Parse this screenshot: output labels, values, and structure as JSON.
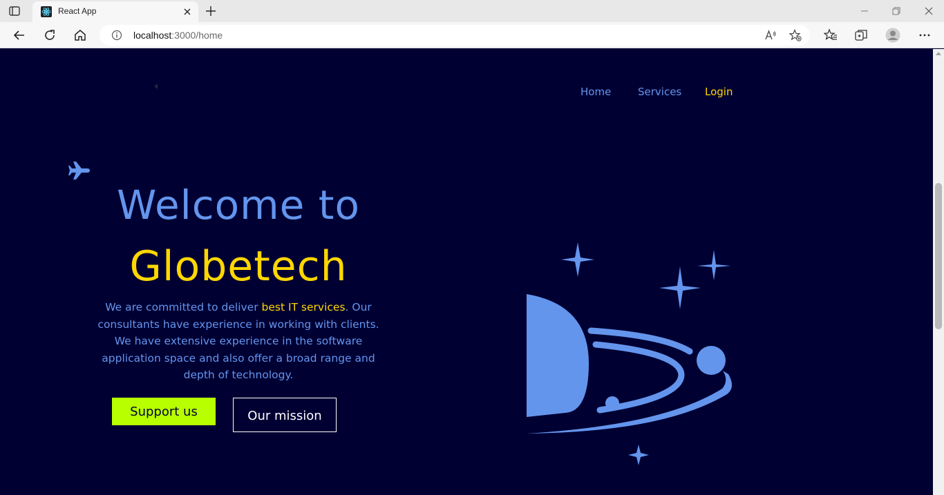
{
  "browser": {
    "tab_title": "React App",
    "url_host": "localhost",
    "url_path": ":3000/home"
  },
  "nav": {
    "home": "Home",
    "services": "Services",
    "login": "Login"
  },
  "hero": {
    "welcome": "Welcome to",
    "brand": "Globetech",
    "text_before": "We are committed to deliver ",
    "text_highlight": "best IT services",
    "text_after": ". Our consultants have experience in working with clients. We have extensive experience in the software application space and also offer a broad range and depth of technology.",
    "support_button": "Support us",
    "mission_button": "Our mission"
  },
  "colors": {
    "background": "#000033",
    "accent_blue": "#6495ed",
    "accent_gold": "#ffd700",
    "button_lime": "#b8ff00"
  }
}
